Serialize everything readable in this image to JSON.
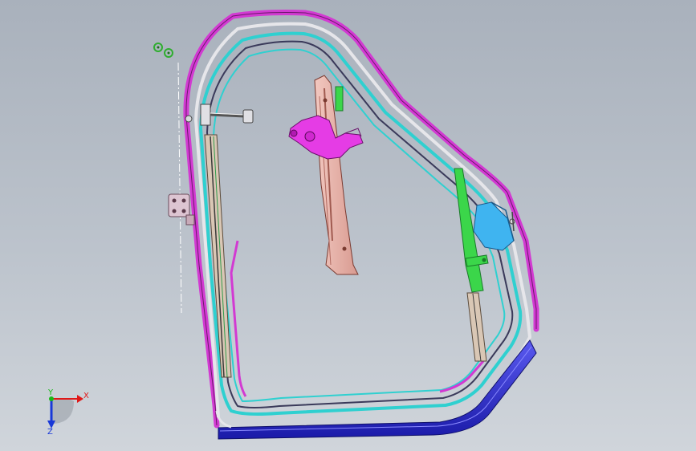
{
  "view": {
    "colors": {
      "background_top": "#a9b1bc",
      "background_bottom": "#d0d5db",
      "frame_outer": "#d23ad2",
      "frame_cyan": "#2fd0d0",
      "frame_dark": "#3a3a5a",
      "rail_blue": "#2b2bd8",
      "regulator_body": "#e8b4ac",
      "motor": "#e53ce5",
      "guide_green": "#3bd64a",
      "bracket_cyan": "#3fb4f0",
      "hardware": "#d8d8dc"
    }
  },
  "triad": {
    "x_label": "X",
    "y_label": "Y",
    "z_label": "Z",
    "x_color": "#e01818",
    "y_color": "#18b818",
    "z_color": "#1838d8"
  }
}
